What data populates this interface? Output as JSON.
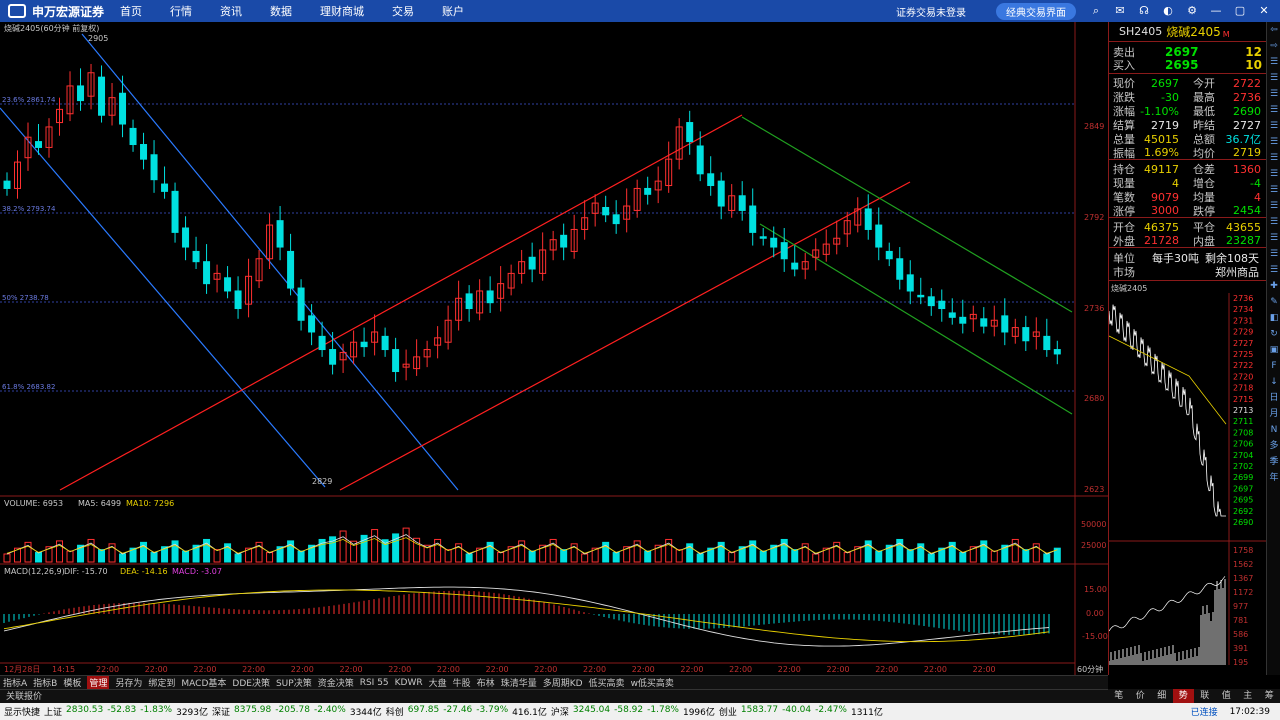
{
  "topbar": {
    "logo": "申万宏源证券",
    "nav": [
      "首页",
      "行情",
      "资讯",
      "数据",
      "理财商城",
      "交易",
      "账户"
    ],
    "login_status": "证券交易未登录",
    "classic_btn": "经典交易界面"
  },
  "chart": {
    "title": "烧碱2405(60分钟 前复权)",
    "price_ticks": [
      "2849",
      "2792",
      "2736",
      "2680",
      "2623"
    ],
    "fib_labels": [
      "23.6% 2861.74",
      "38.2% 2793.74",
      "50% 2738.78",
      "61.8% 2683.82"
    ],
    "high_marker": "2905",
    "low_marker": "2829",
    "volume_label": "VOLUME: 6953",
    "ma5_label": "MA5: 6499",
    "ma10_label": "MA10: 7296",
    "vol_ticks": [
      "50000",
      "25000"
    ],
    "macd_label": "MACD(12,26,9)",
    "dif_label": "DIF: -15.70",
    "dea_label": "DEA: -14.16",
    "macd_val_label": "MACD: -3.07",
    "macd_ticks": [
      "15.00",
      "0.00",
      "-15.00"
    ],
    "time_labels": [
      "12月28日",
      "14:15",
      "22:00",
      "22:00",
      "22:00",
      "22:00",
      "22:00",
      "22:00",
      "22:00",
      "22:00",
      "22:00",
      "22:00",
      "22:00",
      "22:00",
      "22:00",
      "22:00",
      "22:00",
      "22:00",
      "22:00",
      "22:00",
      "22:00"
    ],
    "period_label": "60分钟"
  },
  "quote": {
    "code": "SH2405",
    "name": "烧碱2405",
    "mark": "M",
    "sell_label": "卖出",
    "sell_price": "2697",
    "sell_vol": "12",
    "buy_label": "买入",
    "buy_price": "2695",
    "buy_vol": "10",
    "rows": [
      [
        "现价",
        "2697",
        "今开",
        "2722"
      ],
      [
        "涨跌",
        "-30",
        "最高",
        "2736"
      ],
      [
        "涨幅",
        "-1.10%",
        "最低",
        "2690"
      ],
      [
        "结算",
        "2719",
        "昨结",
        "2727"
      ],
      [
        "总量",
        "45015",
        "总额",
        "36.7亿"
      ],
      [
        "振幅",
        "1.69%",
        "均价",
        "2719"
      ],
      [
        "持仓",
        "49117",
        "仓差",
        "1360"
      ],
      [
        "现量",
        "4",
        "增仓",
        "-4"
      ],
      [
        "笔数",
        "9079",
        "均量",
        "4"
      ],
      [
        "涨停",
        "3000",
        "跌停",
        "2454"
      ],
      [
        "开仓",
        "46375",
        "平仓",
        "43655"
      ],
      [
        "外盘",
        "21728",
        "内盘",
        "23287"
      ]
    ],
    "unit_label": "单位",
    "unit_value": "每手30吨",
    "remain": "剩余108天",
    "market_label": "市场",
    "market_value": "郑州商品"
  },
  "mini": {
    "title": "烧碱2405",
    "price_ticks": [
      "2736",
      "2734",
      "2731",
      "2729",
      "2727",
      "2725",
      "2722",
      "2720",
      "2718",
      "2715",
      "2713",
      "2711",
      "2708",
      "2706",
      "2704",
      "2702",
      "2699",
      "2697",
      "2695",
      "2692",
      "2690"
    ],
    "vol_ticks": [
      "1758",
      "1562",
      "1367",
      "1172",
      "977",
      "781",
      "586",
      "391",
      "195"
    ]
  },
  "right_strip": [
    "⇦",
    "⇨",
    "☰",
    "☰",
    "☰",
    "☰",
    "☰",
    "☰",
    "☰",
    "☰",
    "☰",
    "☰",
    "☰",
    "☰",
    "☰",
    "☰",
    "✚",
    "✎",
    "◧",
    "↻",
    "▣",
    "F",
    "↓",
    "日",
    "月",
    "N",
    "多",
    "季",
    "年"
  ],
  "bottom_tabs": [
    "指标A",
    "指标B",
    "模板",
    "管理",
    "另存为",
    "绑定到",
    "MACD基本",
    "DDE决策",
    "SUP决策",
    "资金决策",
    "RSI 55",
    "KDWR",
    "大盘",
    "牛股",
    "布林",
    "珠清华量",
    "多周期KD",
    "低买高卖",
    "w低买高卖"
  ],
  "active_tab": "管理",
  "link_bar": "关联报价",
  "right_tabs": [
    "笔",
    "价",
    "细",
    "势",
    "联",
    "值",
    "主",
    "筹"
  ],
  "right_active": "势",
  "status": {
    "quick": "显示快捷",
    "items": [
      {
        "t": "上证",
        "c": ""
      },
      {
        "t": "2830.53",
        "c": "g"
      },
      {
        "t": "-52.83",
        "c": "g"
      },
      {
        "t": "-1.83%",
        "c": "g"
      },
      {
        "t": "3293亿",
        "c": ""
      },
      {
        "t": "深证",
        "c": ""
      },
      {
        "t": "8375.98",
        "c": "g"
      },
      {
        "t": "-205.78",
        "c": "g"
      },
      {
        "t": "-2.40%",
        "c": "g"
      },
      {
        "t": "3344亿",
        "c": ""
      },
      {
        "t": "科创",
        "c": ""
      },
      {
        "t": "697.85",
        "c": "g"
      },
      {
        "t": "-27.46",
        "c": "g"
      },
      {
        "t": "-3.79%",
        "c": "g"
      },
      {
        "t": "416.1亿",
        "c": ""
      },
      {
        "t": "沪深",
        "c": ""
      },
      {
        "t": "3245.04",
        "c": "g"
      },
      {
        "t": "-58.92",
        "c": "g"
      },
      {
        "t": "-1.78%",
        "c": "g"
      },
      {
        "t": "1996亿",
        "c": ""
      },
      {
        "t": "创业",
        "c": ""
      },
      {
        "t": "1583.77",
        "c": "g"
      },
      {
        "t": "-40.04",
        "c": "g"
      },
      {
        "t": "-2.47%",
        "c": "g"
      },
      {
        "t": "1311亿",
        "c": ""
      }
    ],
    "connected": "已连接",
    "time": "17:02:39"
  }
}
